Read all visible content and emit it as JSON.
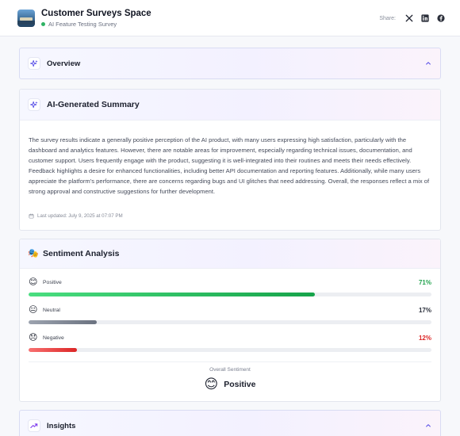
{
  "header": {
    "title": "Customer Surveys Space",
    "subtitle": "AI Feature Testing Survey",
    "share_label": "Share:",
    "social": [
      "x-icon",
      "linkedin-icon",
      "facebook-icon"
    ]
  },
  "overview": {
    "title": "Overview"
  },
  "summary": {
    "title": "AI-Generated Summary",
    "body": "The survey results indicate a generally positive perception of the AI product, with many users expressing high satisfaction, particularly with the dashboard and analytics features. However, there are notable areas for improvement, especially regarding technical issues, documentation, and customer support. Users frequently engage with the product, suggesting it is well-integrated into their routines and meets their needs effectively. Feedback highlights a desire for enhanced functionalities, including better API documentation and reporting features. Additionally, while many users appreciate the platform’s performance, there are concerns regarding bugs and UI glitches that need addressing. Overall, the responses reflect a mix of strong approval and constructive suggestions for further development.",
    "updated": "Last updated: July 9, 2025 at 07:07 PM"
  },
  "sentiment": {
    "title": "Sentiment Analysis",
    "title_emoji": "🎭",
    "items": [
      {
        "emoji": "😊",
        "label": "Positive",
        "pct_label": "71%",
        "value": 0.71,
        "color": "#22b45a",
        "pct_color": "#23a34f"
      },
      {
        "emoji": "😐",
        "label": "Neutral",
        "pct_label": "17%",
        "value": 0.17,
        "color": "#6b7280",
        "pct_color": "#2b303c"
      },
      {
        "emoji": "😞",
        "label": "Negative",
        "pct_label": "12%",
        "value": 0.12,
        "color": "#e03a3a",
        "pct_color": "#dc2626"
      }
    ],
    "overall_label": "Overall Sentiment",
    "overall_emoji": "😊",
    "overall_value": "Positive"
  },
  "insights": {
    "title": "Insights"
  },
  "colors": {
    "accent": "#6366f1",
    "positive": "#22b45a",
    "negative": "#e03a3a"
  }
}
